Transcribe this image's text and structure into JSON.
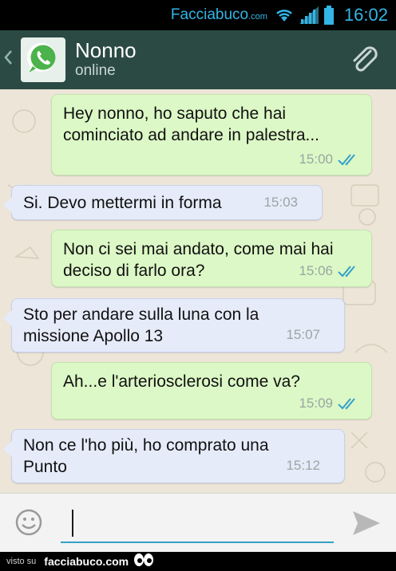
{
  "status_bar": {
    "brand_name": "Facciabuco",
    "brand_tld": ".com",
    "time": "16:02",
    "icons": [
      "wifi-icon",
      "signal-icon",
      "battery-icon"
    ],
    "accent_color": "#33b5e5"
  },
  "header": {
    "contact_name": "Nonno",
    "status": "online",
    "back_icon": "chevron-left-icon",
    "avatar_icon": "whatsapp-logo-icon",
    "attach_icon": "paperclip-icon",
    "background_color": "#2c4a44"
  },
  "messages": [
    {
      "direction": "out",
      "text": "Hey nonno, ho saputo che hai cominciato ad andare in palestra...",
      "time": "15:00",
      "read": true
    },
    {
      "direction": "in",
      "text": "Si. Devo mettermi in forma",
      "time": "15:03"
    },
    {
      "direction": "out",
      "text": "Non ci sei mai andato, come mai hai deciso di farlo ora?",
      "time": "15:06",
      "read": true
    },
    {
      "direction": "in",
      "text": "Sto per andare sulla luna con la missione Apollo 13",
      "time": "15:07"
    },
    {
      "direction": "out",
      "text": "Ah...e l'arteriosclerosi come va?",
      "time": "15:09",
      "read": true
    },
    {
      "direction": "in",
      "text": "Non ce l'ho più, ho comprato una Punto",
      "time": "15:12"
    }
  ],
  "colors": {
    "outgoing_bubble": "#dcf8c6",
    "incoming_bubble": "#e6ebfa",
    "read_ticks": "#34a0c9",
    "chat_background": "#ece5d8"
  },
  "composer": {
    "emoji_icon": "smiley-icon",
    "message_value": "",
    "send_icon": "send-icon"
  },
  "footer": {
    "seen_on": "visto su",
    "site": "facciabuco.com",
    "mascot_icon": "eyes-mascot-icon"
  }
}
